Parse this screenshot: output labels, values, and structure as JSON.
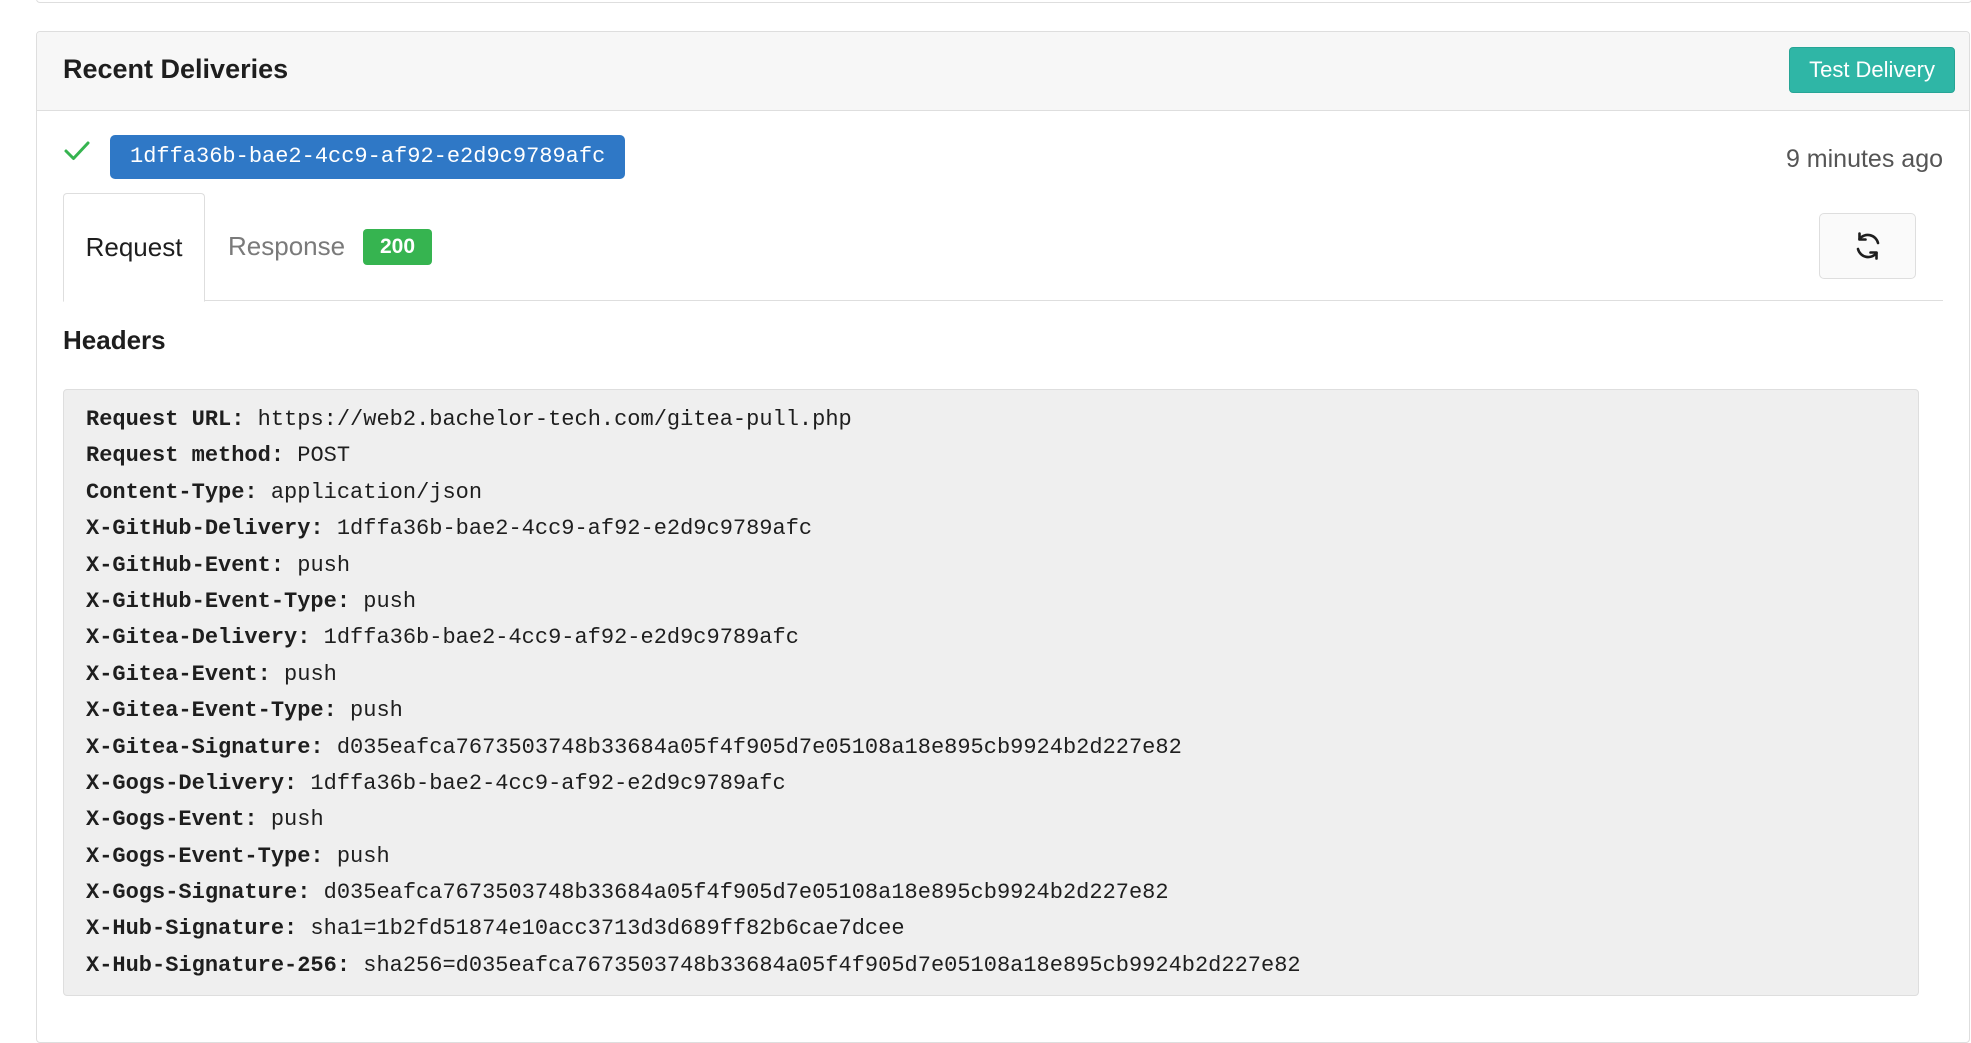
{
  "recent_deliveries": {
    "title": "Recent Deliveries",
    "test_delivery_label": "Test Delivery"
  },
  "delivery": {
    "status_icon": "check-icon",
    "id": "1dffa36b-bae2-4cc9-af92-e2d9c9789afc",
    "time": "9 minutes ago"
  },
  "tabs": {
    "request_label": "Request",
    "response_label": "Response",
    "response_status": "200",
    "refresh_icon": "refresh-icon"
  },
  "headers": {
    "title": "Headers",
    "lines": [
      {
        "key": "Request URL:",
        "value": "https://web2.bachelor-tech.com/gitea-pull.php"
      },
      {
        "key": "Request method:",
        "value": "POST"
      },
      {
        "key": "Content-Type:",
        "value": "application/json"
      },
      {
        "key": "X-GitHub-Delivery:",
        "value": "1dffa36b-bae2-4cc9-af92-e2d9c9789afc"
      },
      {
        "key": "X-GitHub-Event:",
        "value": "push"
      },
      {
        "key": "X-GitHub-Event-Type:",
        "value": "push"
      },
      {
        "key": "X-Gitea-Delivery:",
        "value": "1dffa36b-bae2-4cc9-af92-e2d9c9789afc"
      },
      {
        "key": "X-Gitea-Event:",
        "value": "push"
      },
      {
        "key": "X-Gitea-Event-Type:",
        "value": "push"
      },
      {
        "key": "X-Gitea-Signature:",
        "value": "d035eafca7673503748b33684a05f4f905d7e05108a18e895cb9924b2d227e82"
      },
      {
        "key": "X-Gogs-Delivery:",
        "value": "1dffa36b-bae2-4cc9-af92-e2d9c9789afc"
      },
      {
        "key": "X-Gogs-Event:",
        "value": "push"
      },
      {
        "key": "X-Gogs-Event-Type:",
        "value": "push"
      },
      {
        "key": "X-Gogs-Signature:",
        "value": "d035eafca7673503748b33684a05f4f905d7e05108a18e895cb9924b2d227e82"
      },
      {
        "key": "X-Hub-Signature:",
        "value": "sha1=1b2fd51874e10acc3713d3d689ff82b6cae7dcee"
      },
      {
        "key": "X-Hub-Signature-256:",
        "value": "sha256=d035eafca7673503748b33684a05f4f905d7e05108a18e895cb9924b2d227e82"
      }
    ]
  },
  "colors": {
    "test_button": "#2fb6a6",
    "delivery_id_bg": "#2f78c6",
    "status_200": "#36b450",
    "check": "#36b450"
  }
}
